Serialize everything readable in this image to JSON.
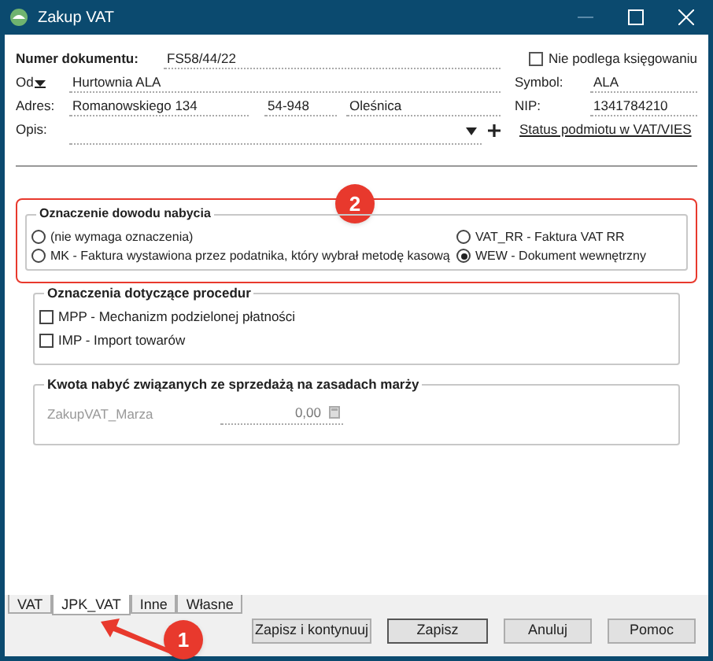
{
  "window": {
    "title": "Zakup VAT"
  },
  "header": {
    "number_label": "Numer dokumentu:",
    "number": "FS58/44/22",
    "not_booked": {
      "label": "Nie podlega księgowaniu",
      "checked": false
    },
    "from_label": "Od",
    "from": "Hurtownia ALA",
    "symbol_label": "Symbol:",
    "symbol": "ALA",
    "address_label": "Adres:",
    "street": "Romanowskiego 134",
    "postcode": "54-948",
    "city": "Oleśnica",
    "nip_label": "NIP:",
    "nip": "1341784210",
    "description_label": "Opis:",
    "status_link": "Status podmiotu w VAT/VIES"
  },
  "proof_group": {
    "title": "Oznaczenie dowodu nabycia",
    "options": [
      {
        "label": "(nie wymaga oznaczenia)",
        "selected": false
      },
      {
        "label": "VAT_RR - Faktura VAT RR",
        "selected": false
      },
      {
        "label": "MK - Faktura wystawiona przez podatnika, który wybrał metodę kasową",
        "selected": false
      },
      {
        "label": "WEW - Dokument wewnętrzny",
        "selected": true
      }
    ]
  },
  "procedures_group": {
    "title": "Oznaczenia dotyczące procedur",
    "options": [
      {
        "label": "MPP - Mechanizm podzielonej płatności",
        "checked": false
      },
      {
        "label": "IMP - Import towarów",
        "checked": false
      }
    ]
  },
  "margin_group": {
    "title": "Kwota nabyć związanych ze sprzedażą na zasadach marży",
    "field_label": "ZakupVAT_Marza",
    "value": "0,00"
  },
  "tabs": [
    {
      "label": "VAT",
      "selected": false
    },
    {
      "label": "JPK_VAT",
      "selected": true
    },
    {
      "label": "Inne",
      "selected": false
    },
    {
      "label": "Własne",
      "selected": false
    }
  ],
  "buttons": [
    "Zapisz i kontynuuj",
    "Zapisz",
    "Anuluj",
    "Pomoc"
  ],
  "annotations": [
    {
      "label": "2"
    },
    {
      "label": "1"
    }
  ]
}
